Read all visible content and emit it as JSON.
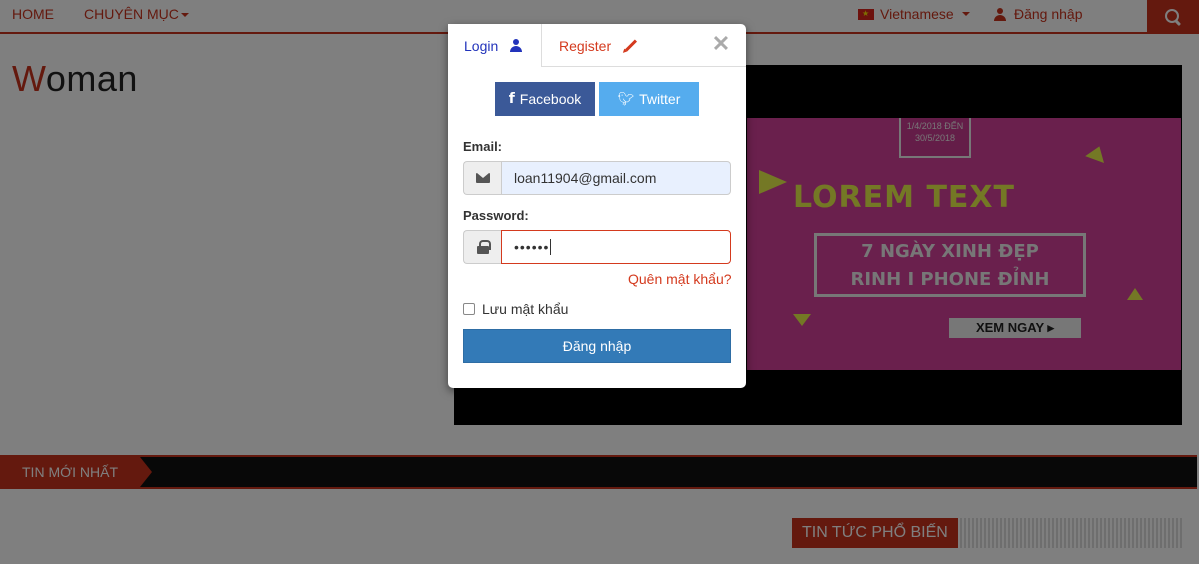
{
  "nav": {
    "home": "HOME",
    "category": "CHUYÊN MỤC",
    "language": "Vietnamese",
    "login": "Đăng nhập"
  },
  "brand": {
    "initial": "W",
    "rest": "oman"
  },
  "banner": {
    "badge": "1/4/2018 ĐẾN 30/5/2018",
    "title": "LOREM TEXT",
    "line1": "7 NGÀY XINH ĐẸP",
    "line2": "RINH I PHONE ĐỈNH",
    "cta": "XEM NGAY ▸"
  },
  "sections": {
    "latest": "TIN MỚI NHẤT",
    "popular": "TIN TỨC PHỔ BIẾN"
  },
  "modal": {
    "tab_login": "Login",
    "tab_register": "Register",
    "close": "✕",
    "facebook": "Facebook",
    "twitter": "Twitter",
    "email_label": "Email:",
    "email_value": "loan11904@gmail.com",
    "password_label": "Password:",
    "password_value": "••••••",
    "forgot": "Quên mật khẩu?",
    "remember": "Lưu mật khẩu",
    "submit": "Đăng nhập"
  },
  "colors": {
    "accent": "#c9321c",
    "primary": "#337ab7",
    "facebook": "#3b5998",
    "twitter": "#55acee",
    "promo_bg": "#d4409a",
    "promo_text": "#e8f04a"
  },
  "icons": [
    "home-icon",
    "caret-down-icon",
    "flag-icon",
    "user-icon",
    "search-icon",
    "pencil-icon",
    "close-icon",
    "facebook-icon",
    "twitter-icon",
    "envelope-icon",
    "lock-icon"
  ]
}
